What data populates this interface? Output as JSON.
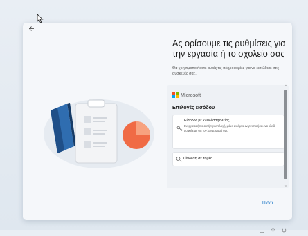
{
  "window": {
    "heading": "Ας ορίσουμε τις ρυθμίσεις για την εργασία ή το σχολείο σας",
    "subtext": "Θα χρησιμοποιήσετε αυτές τις πληροφορίες για να εισέλθετε στις συσκευές σας."
  },
  "microsoft": {
    "name": "Microsoft"
  },
  "signin": {
    "title": "Επιλογές εισόδου",
    "security_key": {
      "title": "Είσοδος με κλειδί ασφαλείας",
      "description": "Ενεργοποιήστε αυτή την επιλογή, μόνο αν έχετε ενεργοποιήσει ένα κλειδί ασφαλείας για τον λογαριασμό σας."
    },
    "domain_join": {
      "label": "Σύνδεση σε τομέα"
    }
  },
  "buttons": {
    "next": "Πίσω"
  },
  "icons": {
    "back": "back-arrow-icon",
    "key": "key-icon",
    "domain": "domain-join-icon",
    "cursor": "mouse-cursor-icon"
  },
  "colors": {
    "accent": "#0067c0",
    "ms_red": "#f25022",
    "ms_green": "#7fba00",
    "ms_blue": "#00a4ef",
    "ms_yellow": "#ffb900"
  }
}
